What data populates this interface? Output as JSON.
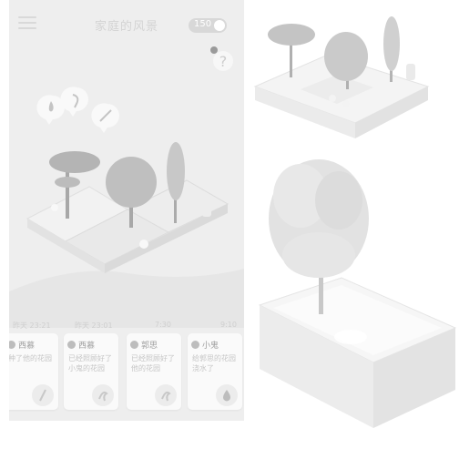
{
  "app": {
    "title": "家庭的风景",
    "coins": "150"
  },
  "timeline": [
    "昨天 23:21",
    "昨天 23:01",
    "7:30",
    "9:10"
  ],
  "cards": [
    {
      "name": "西慕",
      "message": "种了他的花园",
      "icon": "stick-icon"
    },
    {
      "name": "西慕",
      "message": "已经照顾好了小鬼的花园",
      "icon": "hand-icon"
    },
    {
      "name": "郭思",
      "message": "已经照顾好了他的花园",
      "icon": "hand-icon"
    },
    {
      "name": "小鬼",
      "message": "给郭思的花园浇水了",
      "icon": "water-drop-icon"
    }
  ],
  "colors": {
    "background": "#eeeeee",
    "card": "#fafafa",
    "tree": "#b4b4b4"
  }
}
